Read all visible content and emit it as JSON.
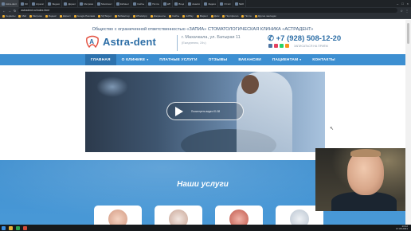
{
  "browser": {
    "tabs": [
      {
        "label": "Astra-dent"
      },
      {
        "label": "ОК"
      },
      {
        "label": "Агрегат"
      },
      {
        "label": "Яндекс"
      },
      {
        "label": "Директ"
      },
      {
        "label": "Метрика"
      },
      {
        "label": "МоиАгент"
      },
      {
        "label": "Кабинет"
      },
      {
        "label": "Сайты"
      },
      {
        "label": "Почта"
      },
      {
        "label": "WP"
      },
      {
        "label": "Вход"
      },
      {
        "label": "Анализ"
      },
      {
        "label": "Задачи"
      },
      {
        "label": "Отчёт"
      },
      {
        "label": "SEO"
      }
    ],
    "url": "astradent.ru/index.html",
    "bookmarks": [
      {
        "label": "Сервисы"
      },
      {
        "label": "Mail"
      },
      {
        "label": "Метрика"
      },
      {
        "label": "Яндекс"
      },
      {
        "label": "Директ"
      },
      {
        "label": "Google Реклама"
      },
      {
        "label": "MyTarget"
      },
      {
        "label": "Вебмастер"
      },
      {
        "label": "WhatsApp"
      },
      {
        "label": "Документы"
      },
      {
        "label": "Сайты"
      },
      {
        "label": "AdPlay"
      },
      {
        "label": "Маркет"
      },
      {
        "label": "Диск"
      },
      {
        "label": "Портфолио"
      },
      {
        "label": "Почта"
      },
      {
        "label": "Другие закладки"
      }
    ]
  },
  "site": {
    "tagline": "Общество с ограниченной ответственностью «ЗАПИА» СТОМАТОЛОГИЧЕСКАЯ КЛИНИКА «АСТРАДЕНТ»",
    "logo_text": "Astra-dent",
    "address": "г. Махачкала, ул. Батырая 11",
    "schedule": "(Ежедневно, 24ч)",
    "phone": "+7 (928) 508-12-20",
    "callback": "ЗАПИСАТЬСЯ НА ПРИЁМ",
    "menu": [
      {
        "label": "ГЛАВНАЯ",
        "dropdown": false
      },
      {
        "label": "О КЛИНИКЕ",
        "dropdown": true
      },
      {
        "label": "ПЛАТНЫЕ УСЛУГИ",
        "dropdown": false
      },
      {
        "label": "ОТЗЫВЫ",
        "dropdown": false
      },
      {
        "label": "ВАКАНСИИ",
        "dropdown": false
      },
      {
        "label": "ПАЦИЕНТАМ",
        "dropdown": true
      },
      {
        "label": "КОНТАКТЫ",
        "dropdown": false
      }
    ],
    "video_label": "Посмотреть видео 01:38",
    "services_title": "Наши услуги",
    "colors": {
      "brand": "#3d8fd1",
      "brand_dark": "#2d72ad",
      "logo_red": "#e24b3b",
      "title": "#2d6ea6"
    }
  },
  "taskbar": {
    "time": "13:12",
    "date": "17.05.2021"
  }
}
